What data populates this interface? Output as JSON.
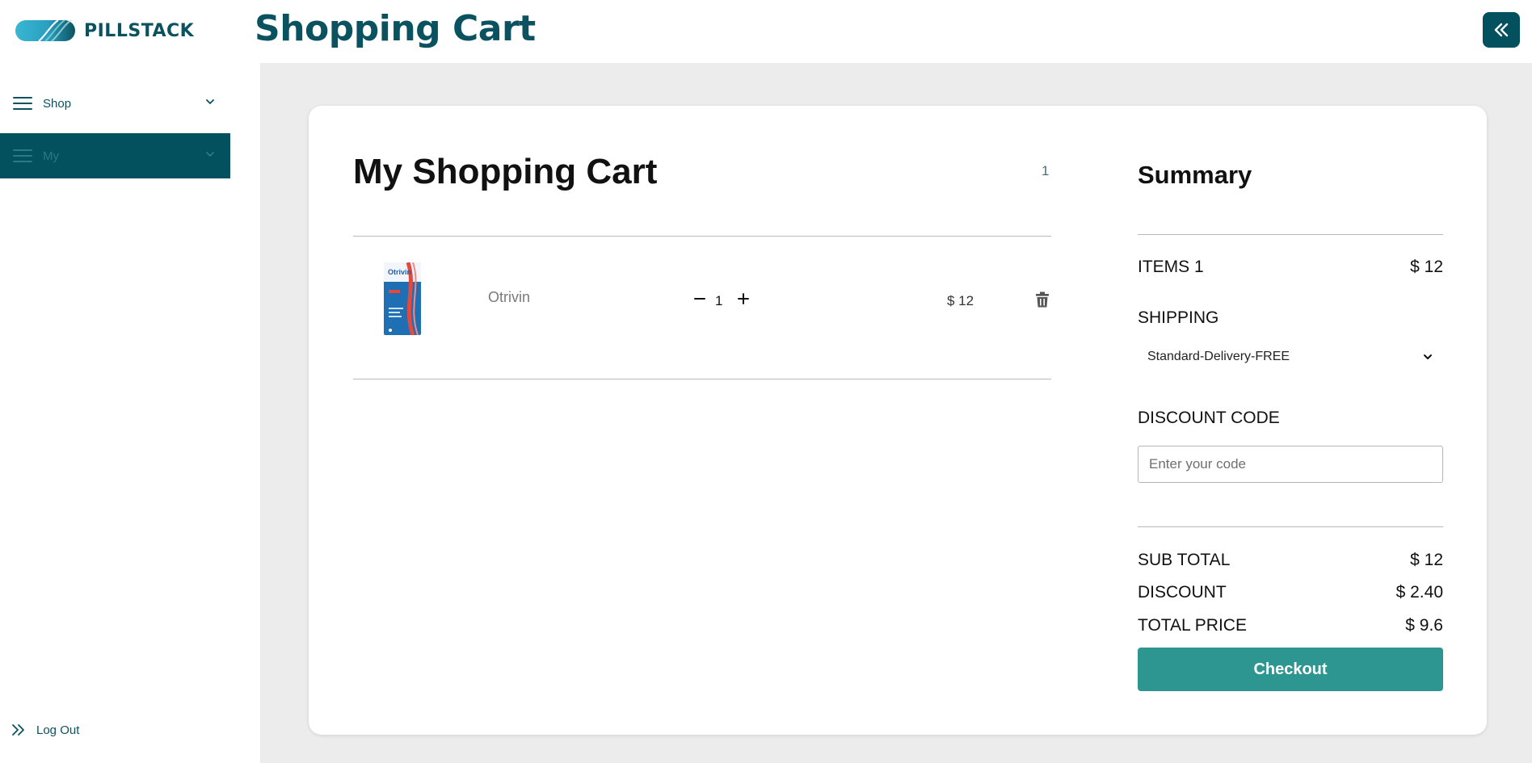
{
  "brand": {
    "name": "PILLSTACK",
    "colors": {
      "primary": "#0b5260",
      "nav_active": "#03505f",
      "checkout": "#2e9691",
      "main_bg": "#ececec"
    }
  },
  "header": {
    "title": "Shopping Cart",
    "collapse_icon": "double-chevron-left-icon"
  },
  "sidebar": {
    "items": [
      {
        "label": "Shop",
        "icon": "hamburger-icon",
        "expanded": false,
        "active": false
      },
      {
        "label": "My",
        "icon": "hamburger-icon",
        "expanded": false,
        "active": true
      }
    ],
    "logout": {
      "label": "Log Out",
      "icon": "double-chevron-right-icon"
    }
  },
  "cart": {
    "title": "My Shopping Cart",
    "count": "1",
    "items": [
      {
        "name": "Otrivin",
        "quantity": "1",
        "price": "$ 12",
        "image_label": "Otrivin"
      }
    ]
  },
  "summary": {
    "title": "Summary",
    "items_label": "ITEMS 1",
    "items_value": "$ 12",
    "shipping_label": "SHIPPING",
    "shipping_selected": "Standard-Delivery-FREE",
    "discount_code_label": "DISCOUNT CODE",
    "discount_code_placeholder": "Enter your code",
    "discount_code_value": "",
    "subtotal_label": "SUB TOTAL",
    "subtotal_value": "$ 12",
    "discount_label": "DISCOUNT",
    "discount_value": "$ 2.40",
    "total_label": "TOTAL PRICE",
    "total_value": "$ 9.6",
    "checkout_label": "Checkout"
  }
}
